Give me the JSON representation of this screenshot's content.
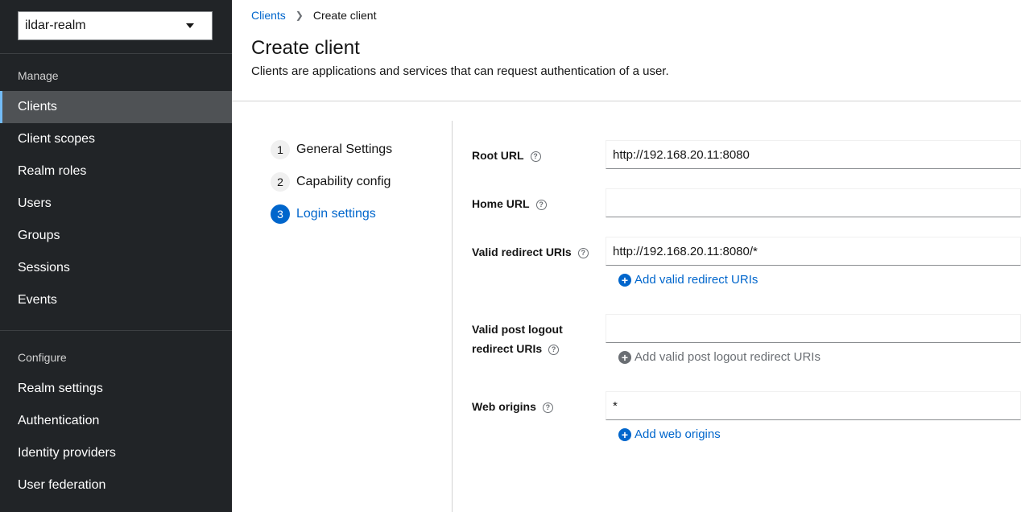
{
  "realm_selector": {
    "value": "ildar-realm"
  },
  "sidebar": {
    "manage_title": "Manage",
    "manage_items": [
      {
        "label": "Clients"
      },
      {
        "label": "Client scopes"
      },
      {
        "label": "Realm roles"
      },
      {
        "label": "Users"
      },
      {
        "label": "Groups"
      },
      {
        "label": "Sessions"
      },
      {
        "label": "Events"
      }
    ],
    "configure_title": "Configure",
    "configure_items": [
      {
        "label": "Realm settings"
      },
      {
        "label": "Authentication"
      },
      {
        "label": "Identity providers"
      },
      {
        "label": "User federation"
      }
    ]
  },
  "breadcrumb": {
    "parent": "Clients",
    "current": "Create client"
  },
  "header": {
    "title": "Create client",
    "description": "Clients are applications and services that can request authentication of a user."
  },
  "wizard": {
    "steps": [
      {
        "num": "1",
        "label": "General Settings"
      },
      {
        "num": "2",
        "label": "Capability config"
      },
      {
        "num": "3",
        "label": "Login settings"
      }
    ]
  },
  "form": {
    "root_url": {
      "label": "Root URL",
      "value": "http://192.168.20.11:8080"
    },
    "home_url": {
      "label": "Home URL",
      "value": ""
    },
    "valid_redirect": {
      "label": "Valid redirect URIs",
      "value": "http://192.168.20.11:8080/*",
      "add_label": "Add valid redirect URIs"
    },
    "post_logout": {
      "label_line1": "Valid post logout",
      "label_line2": "redirect URIs",
      "value": "",
      "add_label": "Add valid post logout redirect URIs"
    },
    "web_origins": {
      "label": "Web origins",
      "value": "*",
      "add_label": "Add web origins"
    }
  },
  "colors": {
    "accent": "#0066cc",
    "sidebar_bg": "#212427",
    "sidebar_active": "#4f5255",
    "active_border": "#73bcf7"
  },
  "icons": {
    "help": "question-circle-icon",
    "add": "plus-circle-icon",
    "dropdown": "caret-down-icon"
  }
}
